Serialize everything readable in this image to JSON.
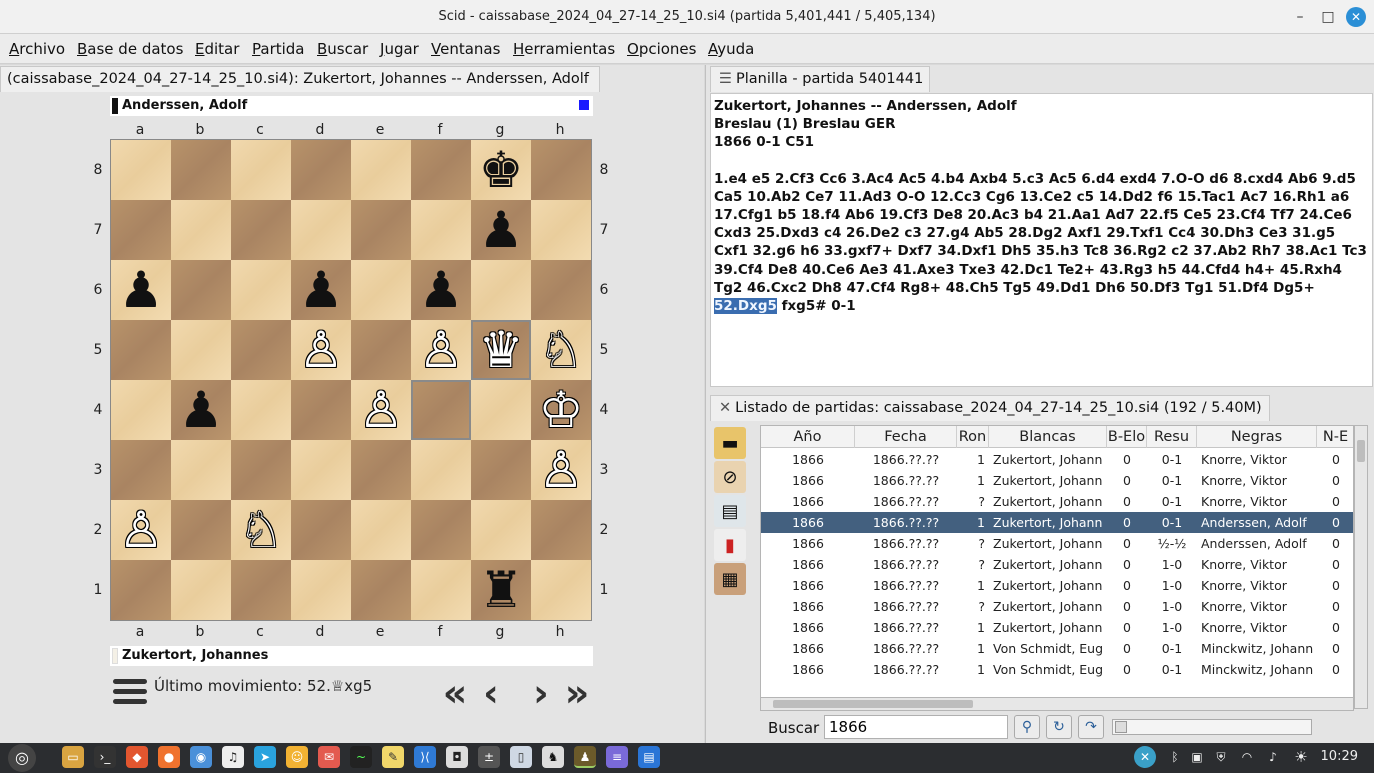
{
  "window": {
    "title": "Scid - caissabase_2024_04_27-14_25_10.si4 (partida 5,401,441 / 5,405,134)"
  },
  "menu": [
    "Archivo",
    "Base de datos",
    "Editar",
    "Partida",
    "Buscar",
    "Jugar",
    "Ventanas",
    "Herramientas",
    "Opciones",
    "Ayuda"
  ],
  "board_panel": {
    "tab": "(caissabase_2024_04_27-14_25_10.si4): Zukertort, Johannes -- Anderssen, Adolf",
    "top_player": "Anderssen, Adolf",
    "bottom_player": "Zukertort, Johannes",
    "files": [
      "a",
      "b",
      "c",
      "d",
      "e",
      "f",
      "g",
      "h"
    ],
    "ranks": [
      "8",
      "7",
      "6",
      "5",
      "4",
      "3",
      "2",
      "1"
    ],
    "pieces": [
      {
        "sq": "g8",
        "p": "♚",
        "c": "b"
      },
      {
        "sq": "g7",
        "p": "♟",
        "c": "b"
      },
      {
        "sq": "a6",
        "p": "♟",
        "c": "b"
      },
      {
        "sq": "d6",
        "p": "♟",
        "c": "b"
      },
      {
        "sq": "f6",
        "p": "♟",
        "c": "b"
      },
      {
        "sq": "d5",
        "p": "♙",
        "c": "w"
      },
      {
        "sq": "f5",
        "p": "♙",
        "c": "w"
      },
      {
        "sq": "g5",
        "p": "♛",
        "c": "w"
      },
      {
        "sq": "h5",
        "p": "♘",
        "c": "w"
      },
      {
        "sq": "b4",
        "p": "♟",
        "c": "b"
      },
      {
        "sq": "e4",
        "p": "♙",
        "c": "w"
      },
      {
        "sq": "h4",
        "p": "♔",
        "c": "w"
      },
      {
        "sq": "h3",
        "p": "♙",
        "c": "w"
      },
      {
        "sq": "a2",
        "p": "♙",
        "c": "w"
      },
      {
        "sq": "c2",
        "p": "♘",
        "c": "w"
      },
      {
        "sq": "g1",
        "p": "♜",
        "c": "b"
      }
    ],
    "highlight": [
      "f4",
      "g5"
    ],
    "last_move": "Último movimiento: 52.♕xg5"
  },
  "notation_panel": {
    "tab": "Planilla - partida 5401441",
    "header1": "Zukertort, Johannes  --  Anderssen, Adolf",
    "header2": "Breslau (1)  Breslau GER",
    "header3": "1866  0-1  C51",
    "moves_before": "1.e4 e5 2.Cf3 Cc6 3.Ac4 Ac5 4.b4 Axb4 5.c3 Ac5 6.d4 exd4 7.O-O d6 8.cxd4 Ab6 9.d5 Ca5 10.Ab2 Ce7 11.Ad3 O-O 12.Cc3 Cg6 13.Ce2 c5 14.Dd2 f6 15.Tac1 Ac7 16.Rh1 a6 17.Cfg1 b5 18.f4 Ab6 19.Cf3 De8 20.Ac3 b4 21.Aa1 Ad7 22.f5 Ce5 23.Cf4 Tf7 24.Ce6 Cxd3 25.Dxd3 c4 26.De2 c3 27.g4 Ab5 28.Dg2 Axf1 29.Txf1 Cc4 30.Dh3 Ce3 31.g5 Cxf1 32.g6 h6 33.gxf7+ Dxf7 34.Dxf1 Dh5 35.h3 Tc8 36.Rg2 c2 37.Ab2 Rh7 38.Ac1 Tc3 39.Cf4 De8 40.Ce6 Ae3 41.Axe3 Txe3 42.Dc1 Te2+ 43.Rg3 h5 44.Cfd4 h4+ 45.Rxh4 Tg2 46.Cxc2 Dh8 47.Cf4 Rg8+ 48.Ch5 Tg5 49.Dd1 Dh6 50.Df3 Tg1 51.Df4 Dg5+",
    "current_move": "52.Dxg5",
    "moves_after": "fxg5# 0-1"
  },
  "gamelist_panel": {
    "tab": "Listado de partidas: caissabase_2024_04_27-14_25_10.si4 (192 / 5.40M)",
    "columns": [
      "Año",
      "Fecha",
      "Ron",
      "Blancas",
      "B-Elo",
      "Resu",
      "Negras",
      "N-E"
    ],
    "rows": [
      [
        "1866",
        "1866.??.??",
        "1",
        "Zukertort, Johanne",
        "0",
        "0-1",
        "Knorre, Viktor",
        "0"
      ],
      [
        "1866",
        "1866.??.??",
        "1",
        "Zukertort, Johanne",
        "0",
        "0-1",
        "Knorre, Viktor",
        "0"
      ],
      [
        "1866",
        "1866.??.??",
        "?",
        "Zukertort, Johanne",
        "0",
        "0-1",
        "Knorre, Viktor",
        "0"
      ],
      [
        "1866",
        "1866.??.??",
        "1",
        "Zukertort, Johanne",
        "0",
        "0-1",
        "Anderssen, Adolf",
        "0"
      ],
      [
        "1866",
        "1866.??.??",
        "?",
        "Zukertort, Johanne",
        "0",
        "½-½",
        "Anderssen, Adolf",
        "0"
      ],
      [
        "1866",
        "1866.??.??",
        "?",
        "Zukertort, Johanne",
        "0",
        "1-0",
        "Knorre, Viktor",
        "0"
      ],
      [
        "1866",
        "1866.??.??",
        "1",
        "Zukertort, Johanne",
        "0",
        "1-0",
        "Knorre, Viktor",
        "0"
      ],
      [
        "1866",
        "1866.??.??",
        "?",
        "Zukertort, Johanne",
        "0",
        "1-0",
        "Knorre, Viktor",
        "0"
      ],
      [
        "1866",
        "1866.??.??",
        "1",
        "Zukertort, Johanne",
        "0",
        "1-0",
        "Knorre, Viktor",
        "0"
      ],
      [
        "1866",
        "1866.??.??",
        "1",
        "Von Schmidt, Eugi",
        "0",
        "0-1",
        "Minckwitz, Johanne",
        "0"
      ],
      [
        "1866",
        "1866.??.??",
        "1",
        "Von Schmidt, Eugi",
        "0",
        "0-1",
        "Minckwitz, Johanne",
        "0"
      ]
    ],
    "selected_row": 3,
    "search_label": "Buscar",
    "search_value": "1866"
  },
  "taskbar": {
    "clock": "10:29"
  },
  "colors": {
    "selection": "#43607f",
    "move_highlight": "#3a6db0",
    "light_square": "#f0d9b0",
    "dark_square": "#b08d66"
  }
}
